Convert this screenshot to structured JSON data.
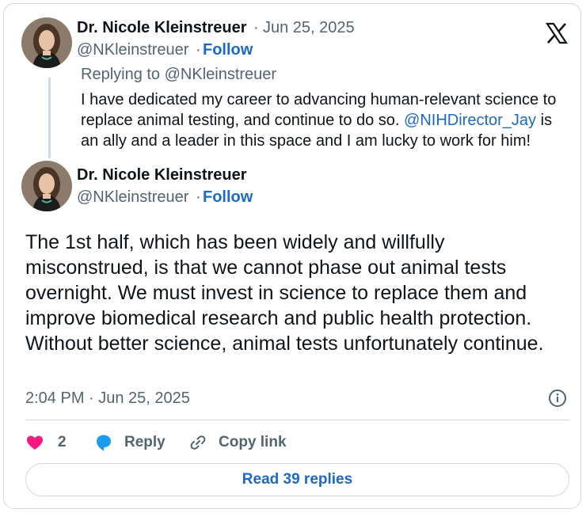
{
  "parent_tweet": {
    "author_name": "Dr. Nicole Kleinstreuer",
    "separator": "·",
    "date": "Jun 25, 2025",
    "handle": "@NKleinstreuer",
    "follow_label": "Follow",
    "replying_to": "Replying to @NKleinstreuer",
    "text_before": "I have dedicated my career to advancing human-relevant science to replace animal testing, and continue to do so. ",
    "mention": "@NIHDirector_Jay",
    "text_after": " is an ally and a leader in this space and I am lucky to work for him!"
  },
  "main_tweet": {
    "author_name": "Dr. Nicole Kleinstreuer",
    "handle": "@NKleinstreuer",
    "separator": "·",
    "follow_label": "Follow",
    "text": "The 1st half, which has been widely and willfully misconstrued, is that we cannot phase out animal tests overnight. We must invest in science to replace them and improve biomedical research and public health protection. Without better science, animal tests unfortunately continue.",
    "timestamp": "2:04 PM · Jun 25, 2025"
  },
  "actions": {
    "like_count": "2",
    "reply_label": "Reply",
    "copy_link_label": "Copy link",
    "read_replies_label": "Read 39 replies"
  },
  "icons": {
    "brand": "x-logo-icon",
    "like": "heart-icon",
    "reply": "speech-bubble-icon",
    "copy": "link-icon",
    "info": "info-icon"
  },
  "colors": {
    "link": "#1d69c4",
    "heart": "#f91880",
    "reply_bubble": "#1d9bf0",
    "secondary_text": "#536471",
    "border": "#cfd9de"
  }
}
